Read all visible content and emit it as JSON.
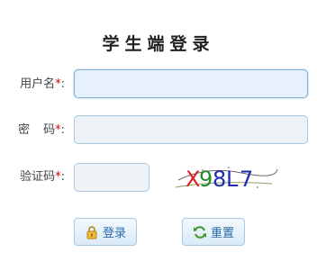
{
  "header": {
    "title": "学生端登录"
  },
  "form": {
    "username_label": "用户名",
    "password_label_1": "密",
    "password_label_2": "码",
    "captcha_label": "验证码",
    "required_mark": "*",
    "colon": ":",
    "username_value": "",
    "password_value": "",
    "captcha_value": "",
    "captcha_text": "X98L7"
  },
  "buttons": {
    "login_label": "登录",
    "reset_label": "重置"
  },
  "icons": {
    "login_icon": "lock-icon",
    "reset_icon": "refresh-icon"
  },
  "colors": {
    "required": "#dd0000",
    "button_text": "#2a6aa8",
    "captcha_red": "#e02020",
    "captcha_green": "#2a8a2a",
    "captcha_blue": "#1c2bb0"
  }
}
